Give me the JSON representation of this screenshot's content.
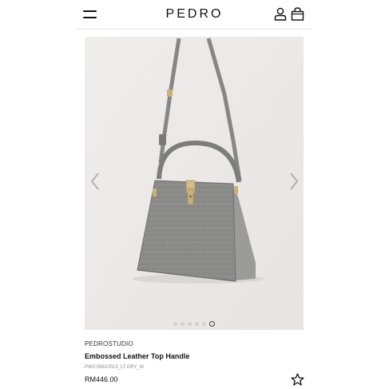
{
  "header": {
    "logo_text": "PEDRO",
    "menu_icon": "hamburger-menu-icon",
    "account_icon": "user-account-icon",
    "bag_icon": "shopping-bag-icon"
  },
  "gallery": {
    "image_description_icon": "handbag-product-image",
    "prev_icon": "chevron-left-icon",
    "next_icon": "chevron-right-icon",
    "total_images": 6,
    "active_index": 6
  },
  "product": {
    "brand": "PEDROSTUDIO",
    "name": "Embossed Leather Top Handle",
    "sku": "PW2-56610013_LT.GRY_M",
    "price": "RM446.00",
    "wishlist_icon": "star-icon"
  },
  "colors": {
    "background": "#ffffff",
    "gallery_bg": "#eeeceb",
    "bag_grey": "#8d8d8c",
    "hardware_gold": "#c8b07a"
  }
}
